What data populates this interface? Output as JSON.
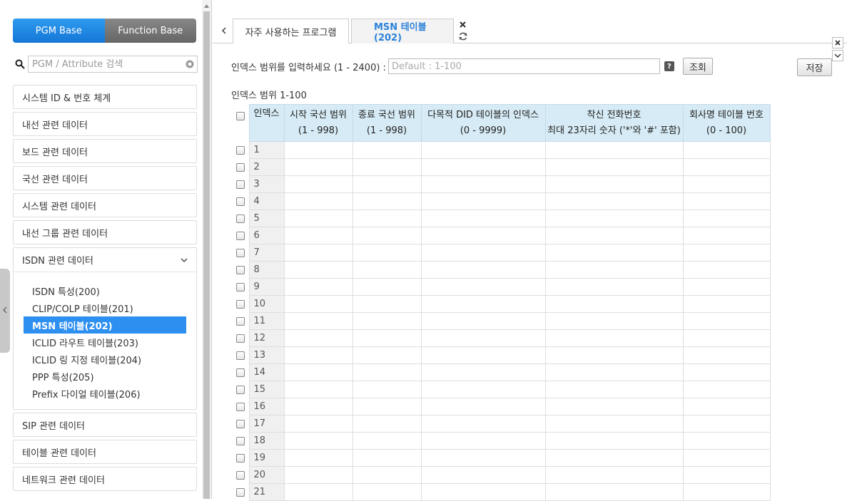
{
  "sidebar": {
    "toggle": {
      "pgm_base": "PGM Base",
      "function_base": "Function Base"
    },
    "search": {
      "placeholder": "PGM / Attribute 검색"
    },
    "menu": [
      "시스템 ID & 번호 체계",
      "내선 관련 데이터",
      "보드 관련 데이터",
      "국선 관련 데이터",
      "시스템 관련 데이터",
      "내선 그룹 관련 데이터"
    ],
    "isdn_group": {
      "label": "ISDN 관련 데이터",
      "items": [
        "ISDN 특성(200)",
        "CLIP/COLP 테이블(201)",
        "MSN 테이블(202)",
        "ICLID 라우트 테이블(203)",
        "ICLID 링 지정 테이블(204)",
        "PPP 특성(205)",
        "Prefix 다이얼 테이블(206)"
      ]
    },
    "menu_after": [
      "SIP 관련 데이터",
      "테이블 관련 데이터",
      "네트워크 관련 데이터"
    ]
  },
  "tabs": {
    "favorites": "자주 사용하는 프로그램",
    "current": "MSN 테이블(202)"
  },
  "form": {
    "range_label": "인덱스 범위를 입력하세요 (1 - 2400) :",
    "range_placeholder": "Default : 1-100",
    "help": "?",
    "query_button": "조회",
    "save_button": "저장",
    "range_info": "인덱스 범위 1-100"
  },
  "table": {
    "headers": [
      {
        "line1": "인덱스",
        "line2": ""
      },
      {
        "line1": "시작 국선 범위",
        "line2": "(1 - 998)"
      },
      {
        "line1": "종료 국선 범위",
        "line2": "(1 - 998)"
      },
      {
        "line1": "다목적 DID 테이블의 인덱스",
        "line2": "(0 - 9999)"
      },
      {
        "line1": "착신 전화번호",
        "line2": "최대 23자리 숫자 ('*'와 '#' 포함)"
      },
      {
        "line1": "회사명 테이블 번호",
        "line2": "(0 - 100)"
      }
    ],
    "rows": [
      "1",
      "2",
      "3",
      "4",
      "5",
      "6",
      "7",
      "8",
      "9",
      "10",
      "11",
      "12",
      "13",
      "14",
      "15",
      "16",
      "17",
      "18",
      "19",
      "20",
      "21"
    ]
  }
}
